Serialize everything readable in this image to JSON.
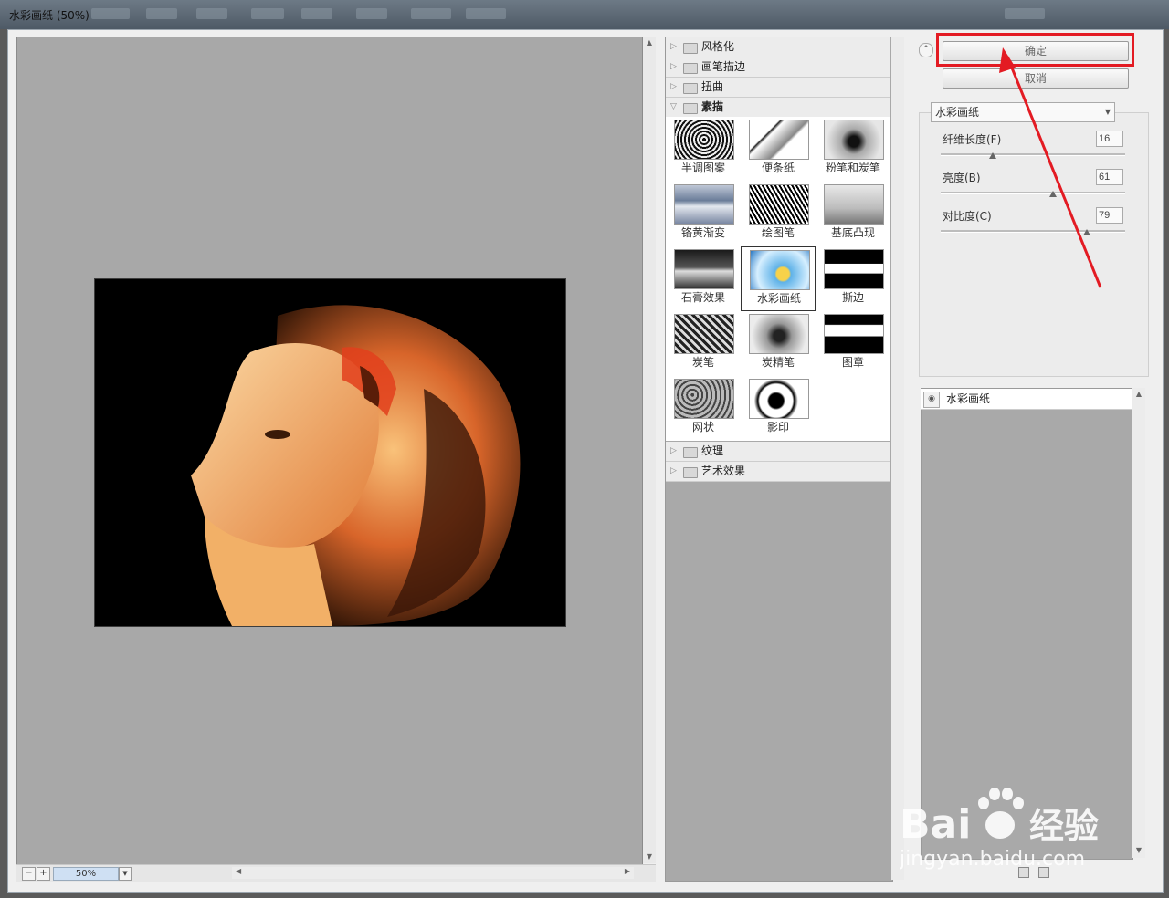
{
  "window": {
    "title": "水彩画纸 (50%)"
  },
  "preview": {
    "zoom": "50%"
  },
  "gallery": {
    "categories_top": [
      "风格化",
      "画笔描边",
      "扭曲"
    ],
    "open_category": "素描",
    "filters": [
      {
        "label": "半调图案"
      },
      {
        "label": "便条纸"
      },
      {
        "label": "粉笔和炭笔"
      },
      {
        "label": "铬黄渐变"
      },
      {
        "label": "绘图笔"
      },
      {
        "label": "基底凸现"
      },
      {
        "label": "石膏效果"
      },
      {
        "label": "水彩画纸"
      },
      {
        "label": "撕边"
      },
      {
        "label": "炭笔"
      },
      {
        "label": "炭精笔"
      },
      {
        "label": "图章"
      },
      {
        "label": "网状"
      },
      {
        "label": "影印"
      }
    ],
    "categories_bottom": [
      "纹理",
      "艺术效果"
    ]
  },
  "actions": {
    "ok": "确定",
    "cancel": "取消"
  },
  "settings": {
    "filter": "水彩画纸",
    "params": [
      {
        "label": "纤维长度(F)",
        "value": "16",
        "fraction": 0.28
      },
      {
        "label": "亮度(B)",
        "value": "61",
        "fraction": 0.61
      },
      {
        "label": "对比度(C)",
        "value": "79",
        "fraction": 0.79
      }
    ]
  },
  "layers": {
    "items": [
      {
        "label": "水彩画纸"
      }
    ]
  },
  "watermark": {
    "brand": "Bai",
    "brand2": "经验",
    "url": "jingyan.baidu.com"
  },
  "colors": {
    "highlight": "#e31b23",
    "arrow": "#e31b23"
  }
}
